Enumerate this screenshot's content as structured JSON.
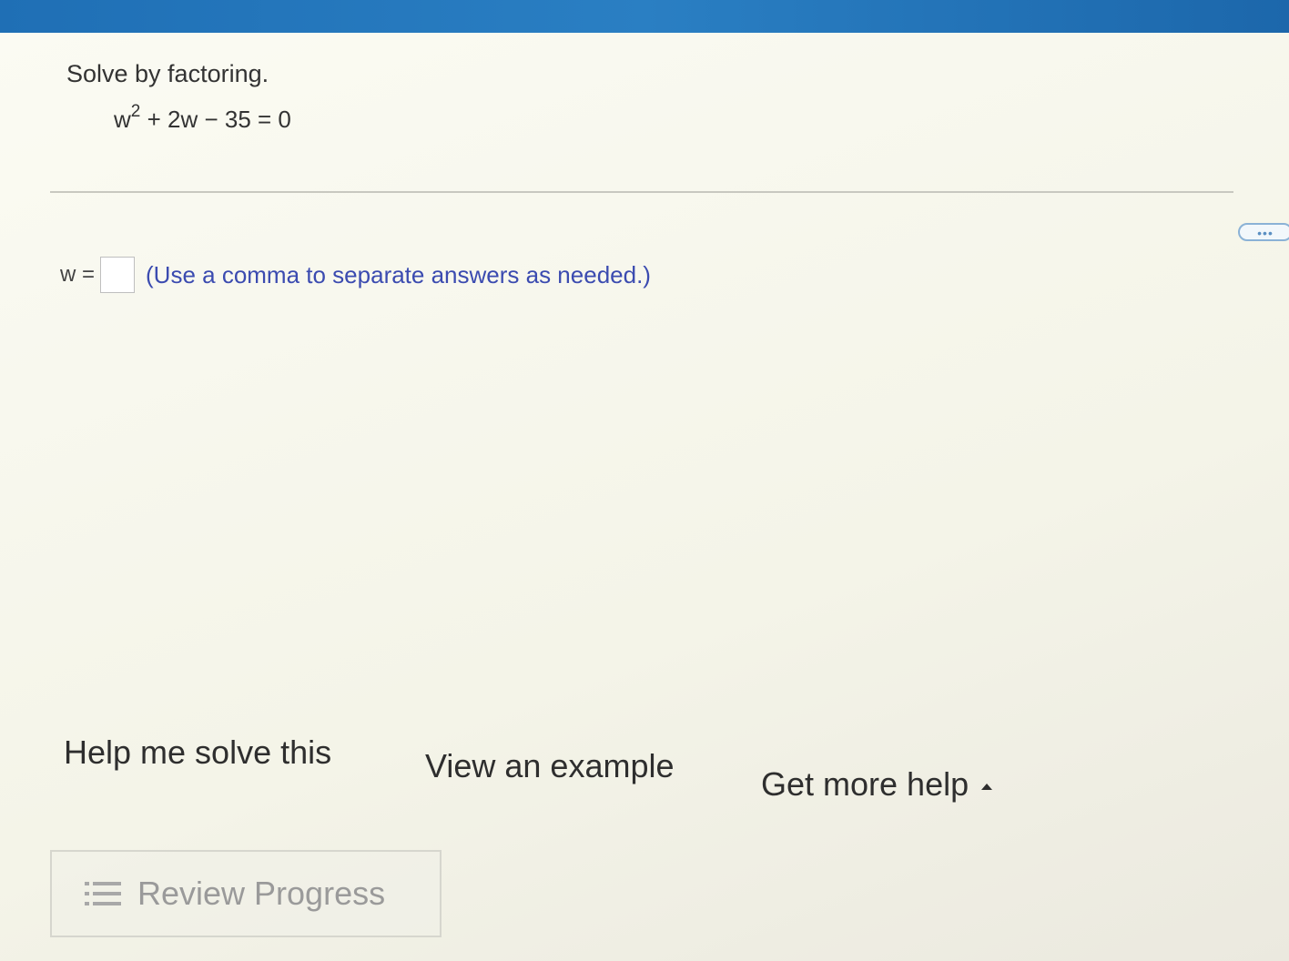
{
  "problem": {
    "instruction": "Solve by factoring.",
    "equation": {
      "base": "w",
      "exponent": "2",
      "rest": " + 2w − 35 = 0"
    }
  },
  "more_button": {
    "label": "•••"
  },
  "answer": {
    "label": "w =",
    "value": "",
    "hint": "(Use a comma to separate answers as needed.)"
  },
  "help": {
    "help_me_solve": "Help me solve this",
    "view_example": "View an example",
    "get_more_help": "Get more help"
  },
  "review": {
    "label": "Review Progress"
  },
  "colors": {
    "header_blue": "#1f6fb5",
    "hint_text": "#3b4bb0",
    "more_button_border": "#8bb2d6"
  }
}
